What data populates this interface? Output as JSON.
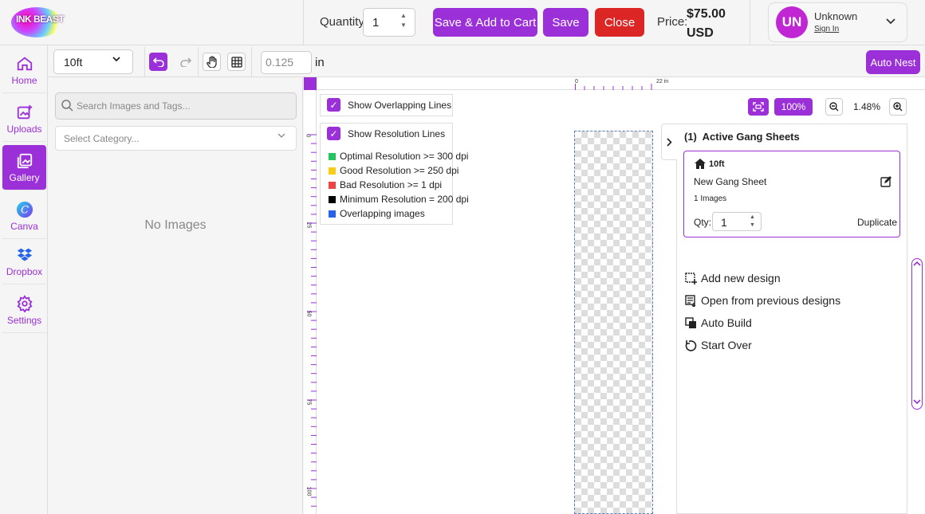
{
  "header": {
    "logo_text": "INK BEAST",
    "quantity_label": "Quantity:",
    "quantity_value": "1",
    "save_add_cart_label": "Save & Add to Cart",
    "save_label": "Save",
    "close_label": "Close",
    "price_label": "Price:",
    "price_value": "$75.00",
    "price_currency": "USD",
    "user": {
      "initials": "UN",
      "name": "Unknown",
      "sign_in": "Sign In"
    }
  },
  "nav": {
    "items": [
      {
        "label": "Home",
        "icon": "home-icon"
      },
      {
        "label": "Uploads",
        "icon": "upload-image-icon"
      },
      {
        "label": "Gallery",
        "icon": "gallery-icon",
        "active": true
      },
      {
        "label": "Canva",
        "icon": "canva-icon"
      },
      {
        "label": "Dropbox",
        "icon": "dropbox-icon"
      },
      {
        "label": "Settings",
        "icon": "gear-icon"
      }
    ]
  },
  "toolbar": {
    "size_value": "10ft",
    "margin_value": "0.125",
    "unit_label": "in",
    "auto_nest_label": "Auto Nest"
  },
  "gallery": {
    "search_placeholder": "Search Images and Tags...",
    "category_placeholder": "Select Category...",
    "empty_message": "No Images"
  },
  "canvas": {
    "ruler_top": [
      "0",
      "22 in"
    ],
    "ruler_left": [
      "0",
      "25",
      "50",
      "75",
      "100"
    ],
    "show_overlapping_label": "Show Overlapping Lines",
    "show_resolution_label": "Show Resolution Lines",
    "legend": [
      {
        "label": "Optimal Resolution >= 300 dpi",
        "color": "#22c55e"
      },
      {
        "label": "Good Resolution >= 250 dpi",
        "color": "#facc15"
      },
      {
        "label": "Bad Resolution >= 1 dpi",
        "color": "#ef4444"
      },
      {
        "label": "Minimum Resolution = 200 dpi",
        "color": "#000000"
      },
      {
        "label": "Overlapping images",
        "color": "#2563eb"
      }
    ],
    "zoom_100_label": "100%",
    "zoom_level": "1.48%"
  },
  "gang_sheets": {
    "count": "(1)",
    "title": "Active Gang Sheets",
    "card": {
      "size": "10ft",
      "name": "New Gang Sheet",
      "images": "1 Images",
      "qty_label": "Qty:",
      "qty_value": "1",
      "duplicate_label": "Duplicate"
    },
    "actions": [
      {
        "label": "Add new design",
        "icon": "add-design-icon"
      },
      {
        "label": "Open from previous designs",
        "icon": "open-designs-icon"
      },
      {
        "label": "Auto Build",
        "icon": "auto-build-icon"
      },
      {
        "label": "Start Over",
        "icon": "restart-icon"
      }
    ]
  },
  "colors": {
    "accent": "#9b30d9",
    "danger": "#dc2626",
    "avatar": "#c026d3"
  }
}
